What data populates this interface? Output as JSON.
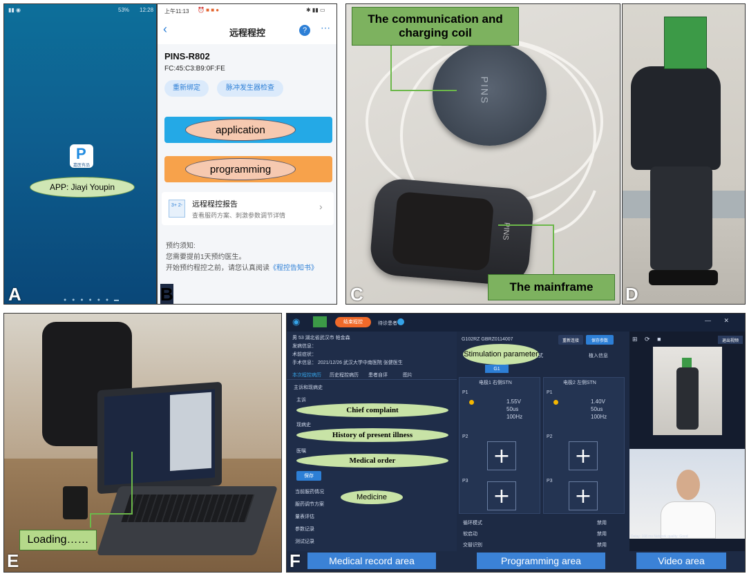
{
  "panel_a": {
    "letter": "A",
    "status_time": "12:28",
    "status_battery": "53%",
    "app_label": "APP: Jiayi Youpin",
    "app_icon_caption": "嘉医有品",
    "app_icon_letter": "P"
  },
  "panel_b": {
    "letter": "B",
    "status_time": "上午11:13",
    "title": "远程程控",
    "device_name": "PINS-R802",
    "mac": "FC:45:C3:B9:0F:FE",
    "rebind_label": "重新绑定",
    "pulse_check_label": "脉冲发生器检查",
    "application_label": "application",
    "programming_label": "programming",
    "report_title": "远程程控报告",
    "report_subtitle": "查看服药方案、刺激参数调节详情",
    "notice_line1": "预约须知:",
    "notice_line2": "您需要提前1天预约医生。",
    "notice_line3": "开始预约程控之前，请您认真阅读",
    "notice_link": "《程控告知书》",
    "report_icon_text": "3+ 2-"
  },
  "panel_c": {
    "letter": "C",
    "coil_label": "The communication and charging coil",
    "mainframe_label": "The mainframe",
    "coil_brand": "PINS",
    "device_brand": "PINS"
  },
  "panel_d": {
    "letter": "D"
  },
  "panel_e": {
    "letter": "E",
    "loading_label": "Loading……"
  },
  "panel_f": {
    "letter": "F",
    "end_button": "结束程控",
    "waiting_label": "待诊患者",
    "patient_info": "男  53  湖北省武汉市  帕金森",
    "onset_label": "发病信息：",
    "symptom_label": "术前症状：",
    "surgery_info": "手术信息：  2021/12/26  武汉大学中南医院  张健医生",
    "tabs": [
      "本次程控病历",
      "历史程控病历",
      "患者自评",
      "图片"
    ],
    "section_history": "主诉和现病史",
    "chief_label": "主诉",
    "chief_complaint": "Chief complaint",
    "present_label": "现病史",
    "history_present": "History of present illness",
    "order_label": "医嘱",
    "medical_order": "Medical order",
    "save_button": "保存",
    "medicine": "Medicine",
    "bottom_items": [
      "当前服药情况",
      "服药调节方案",
      "量表评估",
      "参数记录",
      "测试记录"
    ],
    "device_code": "G102RZ  GBRZ0114007",
    "reset_button": "重新连接",
    "save_params": "保存参数",
    "tab_mode": "模式",
    "implant_info": "植入信息",
    "group": "G1",
    "stim_label": "Stimulation parameter",
    "left_electrode": "电极1 右侧STN",
    "right_electrode": "电极2 左侧STN",
    "left_params": [
      "1.55V",
      "50us",
      "100Hz"
    ],
    "right_params": [
      "1.40V",
      "50us",
      "100Hz"
    ],
    "p_labels": [
      "P1",
      "P2",
      "P3"
    ],
    "list_rows": [
      "循环模式",
      "软启动",
      "交替识别"
    ],
    "row_value": "禁用",
    "exit_video": "退出视频",
    "delay_text": "Delay: 108 ms  Network quality: Good",
    "area_medical": "Medical record area",
    "area_programming": "Programming area",
    "area_video": "Video area"
  }
}
